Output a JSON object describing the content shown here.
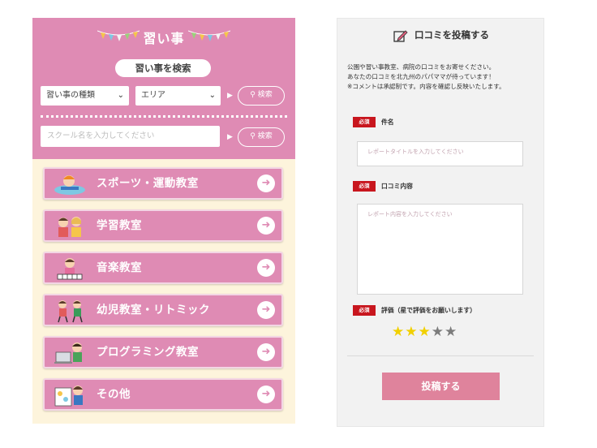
{
  "left": {
    "title": "習い事",
    "search_label": "習い事を検索",
    "type_select": "習い事の種類",
    "area_select": "エリア",
    "search_button": "検索",
    "name_placeholder": "スクール名を入力してください",
    "name_search_button": "検索",
    "categories": [
      {
        "label": "スポーツ・運動教室",
        "icon": "sports-icon"
      },
      {
        "label": "学習教室",
        "icon": "study-icon"
      },
      {
        "label": "音楽教室",
        "icon": "music-icon"
      },
      {
        "label": "幼児教室・リトミック",
        "icon": "toddler-icon"
      },
      {
        "label": "プログラミング教室",
        "icon": "programming-icon"
      },
      {
        "label": "その他",
        "icon": "other-icon"
      }
    ]
  },
  "right": {
    "title": "口コミを投稿する",
    "intro": [
      "公園や習い事教室、病院の口コミをお寄せください。",
      "あなたの口コミを北九州のパパママが待っています！",
      "※コメントは承認制です。内容を確認し反映いたします。"
    ],
    "required_badge": "必須",
    "subject_label": "件名",
    "subject_placeholder": "レポートタイトルを入力してください",
    "content_label": "口コミ内容",
    "content_placeholder": "レポート内容を入力してください",
    "rating_label": "評価（星で評価をお願いします）",
    "rating": {
      "value": 3,
      "max": 5
    },
    "submit_label": "投稿する"
  },
  "colors": {
    "accent_pink": "#df8bb4",
    "panel_bg": "#fdf4dc",
    "required_red": "#c8161e",
    "star_on": "#f1d000",
    "star_off": "#7c7c7c",
    "submit": "#df839c"
  }
}
